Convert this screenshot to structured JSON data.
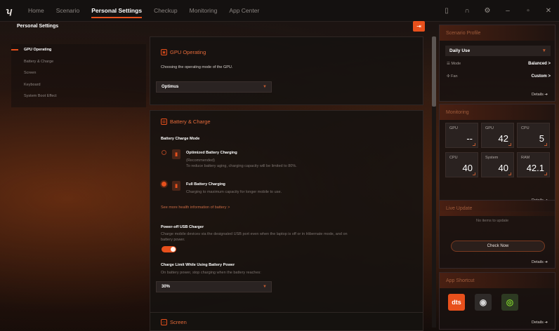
{
  "nav": {
    "tabs": [
      "Home",
      "Scenario",
      "Personal Settings",
      "Checkup",
      "Monitoring",
      "App Center"
    ],
    "active": "Personal Settings"
  },
  "sidebar": {
    "title": "Personal Settings",
    "items": [
      {
        "label": "GPU Operating",
        "active": true
      },
      {
        "label": "Battery & Charge",
        "active": false
      },
      {
        "label": "Screen",
        "active": false
      },
      {
        "label": "Keyboard",
        "active": false
      },
      {
        "label": "System Boot Effect",
        "active": false
      }
    ]
  },
  "gpu": {
    "title": "GPU Operating",
    "description": "Choosing the operating mode of the GPU.",
    "mode_value": "Optimus"
  },
  "battery": {
    "title": "Battery & Charge",
    "charge_mode_label": "Battery Charge Mode",
    "options": [
      {
        "title": "Optimized Battery Charging",
        "sub1": "(Recommended)",
        "sub2": "To reduce battery aging, charging capacity will be limited to 80%.",
        "selected": false
      },
      {
        "title": "Full Battery Charging",
        "sub1": "Charging to maximum capacity for longer mobile to use.",
        "selected": true
      }
    ],
    "health_link": "See more health information of battery  >",
    "usb_title": "Power-off USB Charger",
    "usb_desc1": "Charge mobile devices via the designated USB port even when the laptop is off or in Hibernate mode, and on",
    "usb_desc2": "battery power.",
    "usb_enabled": true,
    "limit_title": "Charge Limit While Using Battery Power",
    "limit_desc": "On battery power, stop charging when the battery reaches:",
    "limit_value": "30%"
  },
  "screen": {
    "title": "Screen"
  },
  "scenario_profile": {
    "title": "Scenario Profile",
    "profile": "Daily Use",
    "mode_label": "Mode",
    "mode_value": "Balanced >",
    "fan_label": "Fan",
    "fan_value": "Custom >",
    "details": "Details  ➔"
  },
  "monitoring": {
    "title": "Monitoring",
    "tiles": [
      {
        "label": "GPU",
        "value": "--"
      },
      {
        "label": "GPU",
        "value": "42"
      },
      {
        "label": "CPU",
        "value": "5"
      },
      {
        "label": "CPU",
        "value": "40"
      },
      {
        "label": "System",
        "value": "40"
      },
      {
        "label": "RAM",
        "value": "42.1"
      }
    ],
    "details": "Details  ➔"
  },
  "live_update": {
    "title": "Live Update",
    "status": "No items to update",
    "button": "Check Now",
    "details": "Details  ➔"
  },
  "app_shortcut": {
    "title": "App Shortcut",
    "apps": [
      "dts"
    ],
    "details": "Details  ➔"
  },
  "colors": {
    "accent": "#e8501c",
    "panel": "#161210"
  }
}
